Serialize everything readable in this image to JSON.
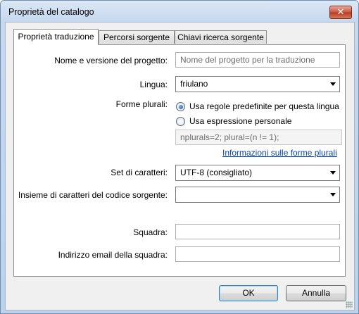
{
  "window": {
    "title": "Proprietà del catalogo",
    "close_glyph": "✕"
  },
  "tabs": [
    {
      "label": "Proprietà traduzione",
      "active": true
    },
    {
      "label": "Percorsi sorgente",
      "active": false
    },
    {
      "label": "Chiavi ricerca sorgente",
      "active": false
    }
  ],
  "form": {
    "project_label": "Nome e versione del progetto:",
    "project_placeholder": "Nome del progetto per la traduzione",
    "language_label": "Lingua:",
    "language_value": "friulano",
    "plural_label": "Forme plurali:",
    "plural_default_label": "Usa regole predefinite per questa lingua",
    "plural_custom_label": "Usa espressione personale",
    "plural_expression": "nplurals=2; plural=(n != 1);",
    "plural_info_link": "Informazioni sulle forme plurali",
    "charset_label": "Set di caratteri:",
    "charset_value": "UTF-8 (consigliato)",
    "source_charset_label": "Insieme di caratteri del codice sorgente:",
    "source_charset_value": "",
    "team_label": "Squadra:",
    "team_value": "",
    "team_email_label": "Indirizzo email della squadra:",
    "team_email_value": ""
  },
  "buttons": {
    "ok": "OK",
    "cancel": "Annulla"
  }
}
